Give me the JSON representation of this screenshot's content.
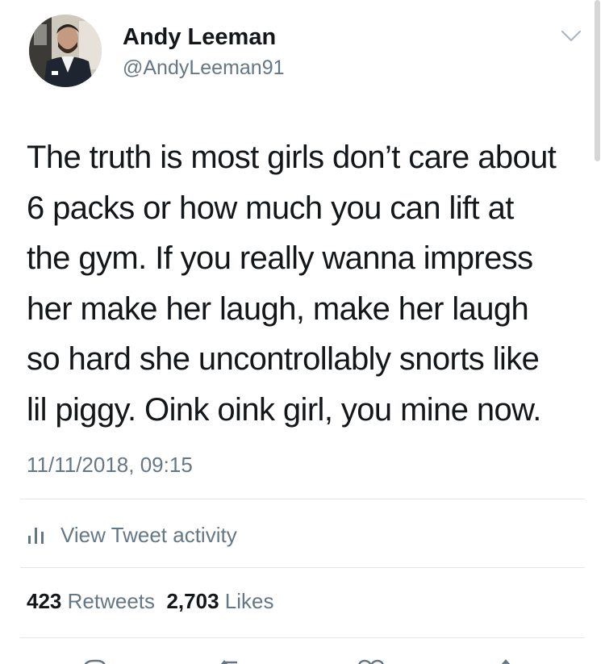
{
  "user": {
    "display_name": "Andy Leeman",
    "handle": "@AndyLeeman91",
    "avatar_icon": "profile-photo"
  },
  "tweet": {
    "lines": [
      "The truth is most girls don’t care about",
      "6 packs or how much you can lift at",
      "the gym. If you really wanna impress",
      "her make her laugh, make her laugh",
      "so hard she uncontrollably snorts like",
      "lil piggy. Oink oink girl, you mine now."
    ],
    "timestamp": "11/11/2018, 09:15"
  },
  "activity": {
    "icon": "bar-chart-icon",
    "label": "View Tweet activity"
  },
  "stats": {
    "retweets_count": "423",
    "retweets_label": "Retweets",
    "likes_count": "2,703",
    "likes_label": "Likes"
  },
  "actions": [
    "reply-icon",
    "retweet-icon",
    "like-icon",
    "share-icon"
  ],
  "colors": {
    "text": "#14171a",
    "secondary": "#657786",
    "divider": "#e1e8ed"
  }
}
